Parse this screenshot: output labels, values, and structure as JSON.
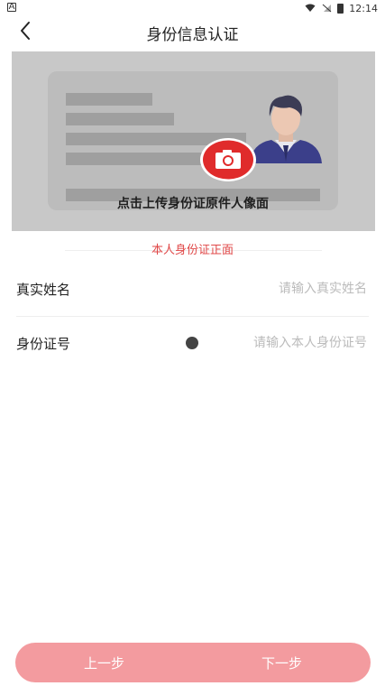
{
  "status_bar": {
    "left_icon": "A",
    "time": "12:14"
  },
  "header": {
    "title": "身份信息认证"
  },
  "id_upload": {
    "prompt": "点击上传身份证原件人像面",
    "section_label": "本人身份证正面"
  },
  "form": {
    "name": {
      "label": "真实姓名",
      "placeholder": "请输入真实姓名",
      "value": ""
    },
    "id_number": {
      "label": "身份证号",
      "placeholder": "请输入本人身份证号",
      "value": ""
    }
  },
  "buttons": {
    "prev_label": "上一步",
    "next_label": "下一步"
  },
  "colors": {
    "accent_red": "#e02b2b",
    "button_pink": "#f39b9f",
    "section_label_red": "#e04848"
  }
}
